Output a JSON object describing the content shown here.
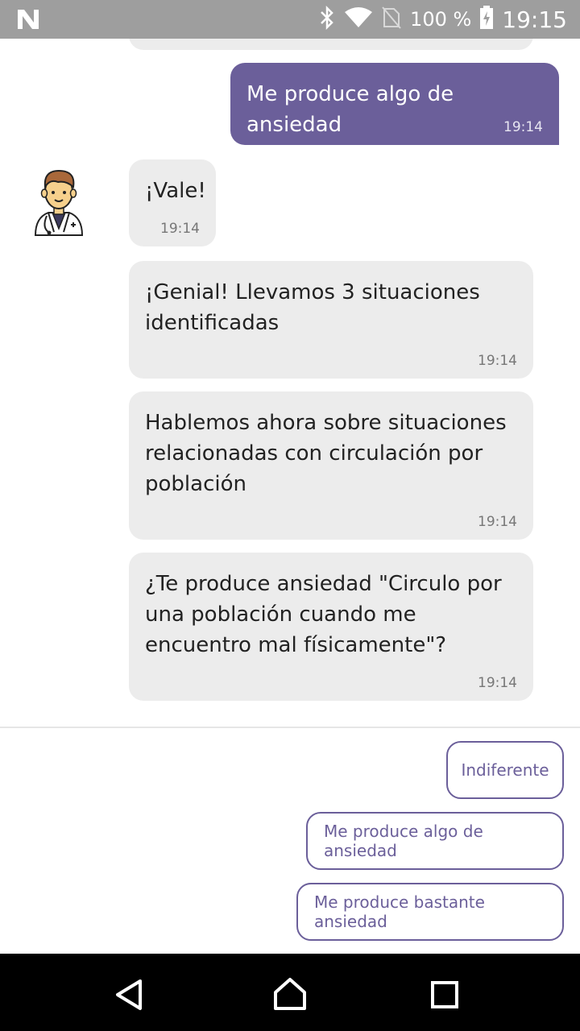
{
  "status_bar": {
    "battery": "100 %",
    "time": "19:15",
    "icons": [
      "n-logo-icon",
      "bluetooth-icon",
      "wifi-icon",
      "no-sim-icon",
      "battery-icon"
    ]
  },
  "messages": [
    {
      "side": "user",
      "text": "Me produce algo de ansiedad",
      "time": "19:14"
    },
    {
      "side": "bot",
      "text": "¡Vale!",
      "time": "19:14"
    },
    {
      "side": "bot",
      "text": "¡Genial! Llevamos 3 situaciones identificadas",
      "time": "19:14"
    },
    {
      "side": "bot",
      "text": "Hablemos ahora sobre situaciones relacionadas con circulación por población",
      "time": "19:14"
    },
    {
      "side": "bot",
      "text": "¿Te produce ansiedad \"Circulo por una población cuando me encuentro mal físicamente\"?",
      "time": "19:14"
    }
  ],
  "quick_replies": [
    "Indiferente",
    "Me produce algo de ansiedad",
    "Me produce bastante ansiedad"
  ],
  "colors": {
    "accent": "#6b5f9a",
    "bot_bubble": "#ececec",
    "status_bar": "#9e9e9e",
    "nav_bar": "#000000"
  },
  "nav": {
    "icons": [
      "back-icon",
      "home-icon",
      "recents-icon"
    ]
  }
}
